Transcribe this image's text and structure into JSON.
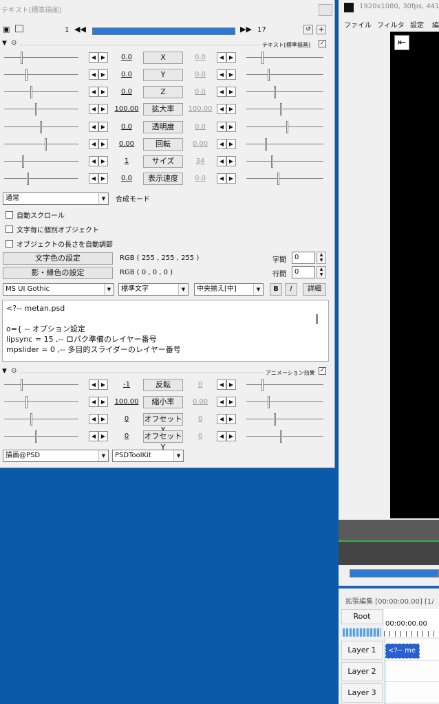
{
  "panel": {
    "title": "テキスト[標準描画]",
    "frame_start": "1",
    "frame_end": "17",
    "filter_label": "テキスト[標準描画]",
    "rows": [
      {
        "left_value": "0.0",
        "name": "X",
        "right_value": "0.0"
      },
      {
        "left_value": "0.0",
        "name": "Y",
        "right_value": "0.0"
      },
      {
        "left_value": "0.0",
        "name": "Z",
        "right_value": "0.0"
      },
      {
        "left_value": "100.00",
        "name": "拡大率",
        "right_value": "100.00"
      },
      {
        "left_value": "0.0",
        "name": "透明度",
        "right_value": "0.0"
      },
      {
        "left_value": "0.00",
        "name": "回転",
        "right_value": "0.00"
      },
      {
        "left_value": "1",
        "name": "サイズ",
        "right_value": "34"
      },
      {
        "left_value": "0.0",
        "name": "表示速度",
        "right_value": "0.0"
      }
    ],
    "blend_mode": "通常",
    "blend_label": "合成モード",
    "checkboxes": [
      "自動スクロール",
      "文字毎に個別オブジェクト",
      "オブジェクトの長さを自動調節"
    ],
    "text_color_btn": "文字色の設定",
    "text_color_value": "RGB ( 255 , 255 , 255 )",
    "shadow_color_btn": "影・縁色の設定",
    "shadow_color_value": "RGB ( 0 , 0 , 0 )",
    "spacing_label": "字間",
    "spacing_value": "0",
    "line_label": "行間",
    "line_value": "0",
    "font": "MS UI Gothic",
    "style": "標準文字",
    "align": "中央揃え[中]",
    "bold": "B",
    "italic": "I",
    "detail": "詳細",
    "text_lines": [
      "<?-- metan.psd",
      "",
      "o={ -- オプション設定",
      "lipsync = 15   ,-- ロパク準備のレイヤー番号",
      "mpslider = 0   ,-- 多目的スライダーのレイヤー番号"
    ],
    "anim_label": "アニメーション効果",
    "anim_rows": [
      {
        "left_value": "-1",
        "name": "反転",
        "right_value": "0"
      },
      {
        "left_value": "100.00",
        "name": "縮小率",
        "right_value": "0.00"
      },
      {
        "left_value": "0",
        "name": "オフセットX",
        "right_value": "0"
      },
      {
        "left_value": "0",
        "name": "オフセットY",
        "right_value": "0"
      }
    ],
    "anim_effect": "描画@PSD",
    "anim_category": "PSDToolKit"
  },
  "main_window": {
    "title": "1920x1080, 30fps, 441",
    "menu": [
      "ファイル",
      "フィルタ",
      "設定",
      "編"
    ]
  },
  "timeline": {
    "title": "拡張編集 [00:00:00.00] [1/",
    "root_label": "Root",
    "timecode": "00:00:00.00",
    "layers": [
      "Layer 1",
      "Layer 2",
      "Layer 3"
    ],
    "clip_text": "<?-- me"
  },
  "colors": {
    "accent": "#2d7ad6",
    "desktop": "#0a5aa8",
    "clip": "#2a5fd0"
  }
}
